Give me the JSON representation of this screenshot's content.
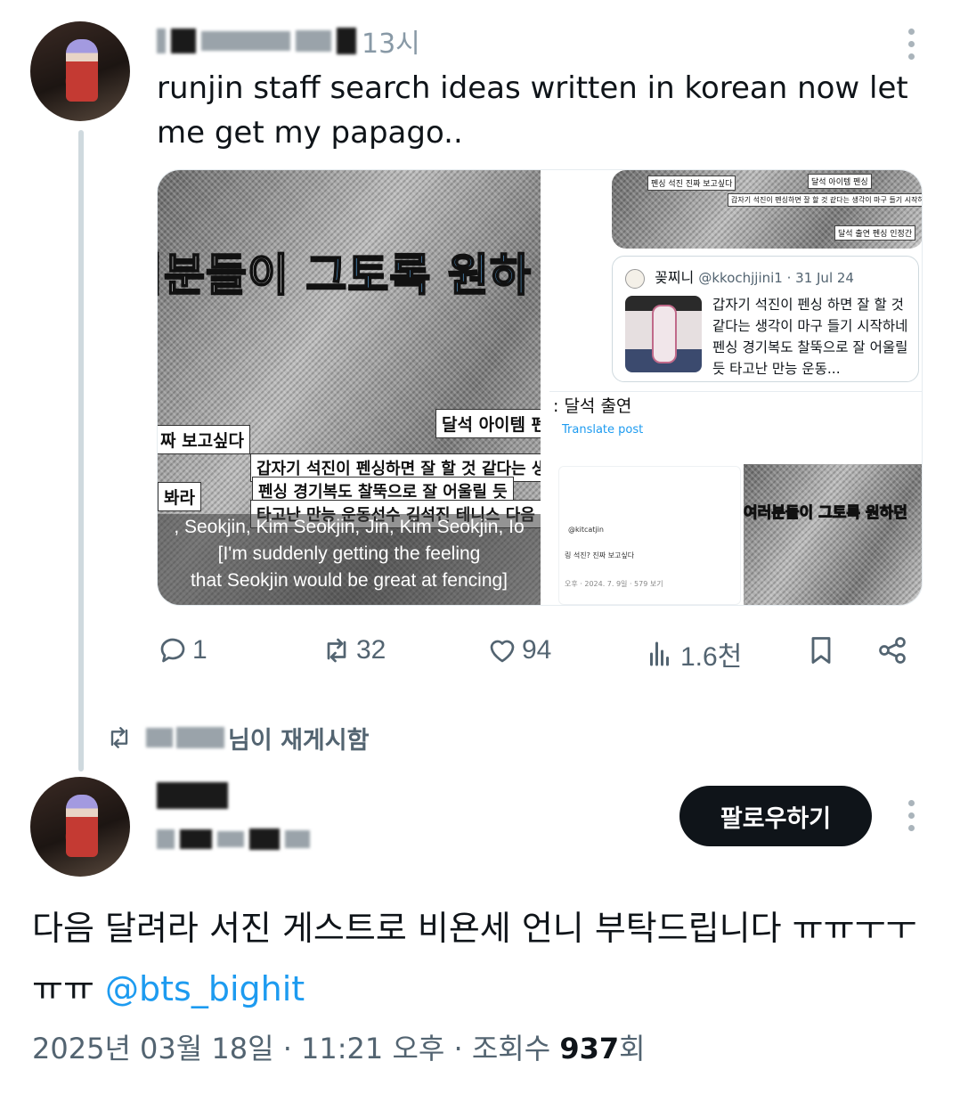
{
  "quoted_tweet": {
    "time": "13시",
    "text": "runjin staff search ideas written in korean now let me get my papago..",
    "media": {
      "left_image": {
        "headline_a": "러분들이 ",
        "headline_b": "그토록 원하",
        "sticker_1": "달석 아이템 펜",
        "sticker_2": "짜 보고싶다",
        "sticker_3": "봐라",
        "sticker_4": "갑자기 석진이 펜싱하면 잘 할 것 같다는 생",
        "sticker_5": "펜싱 경기복도 찰뚝으로 잘 어울릴 듯",
        "sticker_6": "타고난 만능 운동선수 김석진 테니스 다음",
        "subtitle_1": ", Seokjin, Kim Seokjin, Jin, Kim Seokjin, Io",
        "subtitle_2": "[I'm suddenly getting the feeling",
        "subtitle_3": "that Seokjin would be great at fencing]"
      },
      "right_panel": {
        "top_sticker_1": "펜싱 석진 진짜 보고싶다",
        "top_sticker_2": "달석 아이템 펜싱",
        "top_sticker_3": "갑자기 석진이 펜싱하면 잘 할 것 같다는 생각이 마구 들기 시작하네",
        "top_sticker_4": "달석 출연 펜싱 인정간",
        "quote": {
          "name": "꽂찌니",
          "handle": "@kkochjjini1 · 31 Jul 24",
          "text": "갑자기 석진이 펜싱 하면 잘 할 것 같다는 생각이 마구 들기 시작하네  펜싱 경기복도 찰뚝으로 잘 어울릴 듯 타고난 만능 운동..."
        },
        "tag": ": 달석 출연",
        "translate": "Translate post",
        "bottom_left_1": "@kitcatjin",
        "bottom_left_2": "링 석진? 진짜 보고싶다",
        "bottom_left_3": "오후 · 2024. 7. 9일 · 579 보기",
        "bottom_right_headline_a": "여러분들이 ",
        "bottom_right_headline_b": "그토록 원하던"
      }
    },
    "actions": {
      "reply_count": "1",
      "repost_count": "32",
      "like_count": "94",
      "views_count": "1.6천"
    }
  },
  "repost_banner": "님이 재게시함",
  "main_tweet": {
    "follow_label": "팔로우하기",
    "text": "다음 달려라 서진 게스트로 비욘세 언니 부탁드립니다 ㅠㅠㅜㅜㅠㅠ ",
    "mention": "@bts_bighit",
    "meta_date": "2025년 03월 18일 · 11:21 오후 · 조회수 ",
    "meta_views": "937",
    "meta_suffix": "회"
  },
  "colors": {
    "accent": "#1d9bf0",
    "text": "#0f1419",
    "muted": "#536471",
    "button_bg": "#0f1419"
  },
  "icons": [
    "reply-icon",
    "repost-icon",
    "like-icon",
    "views-icon",
    "bookmark-icon",
    "share-icon",
    "more-icon"
  ]
}
